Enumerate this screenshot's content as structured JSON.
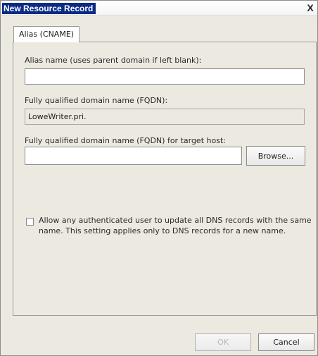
{
  "window": {
    "title": "New Resource Record",
    "close_glyph": "X"
  },
  "tab": {
    "label": "Alias (CNAME)"
  },
  "alias": {
    "label": "Alias name (uses parent domain if left blank):",
    "value": ""
  },
  "fqdn": {
    "label": "Fully qualified domain name (FQDN):",
    "value": "LoweWriter.pri."
  },
  "target": {
    "label": "Fully qualified domain name (FQDN) for target host:",
    "value": "",
    "browse_label": "Browse..."
  },
  "permission": {
    "checked": false,
    "line1": "Allow any authenticated user to update all DNS records with the same",
    "line2": "name. This setting applies only to DNS records for a new name."
  },
  "footer": {
    "ok_label": "OK",
    "cancel_label": "Cancel"
  },
  "icons": {
    "close": "close-icon"
  }
}
